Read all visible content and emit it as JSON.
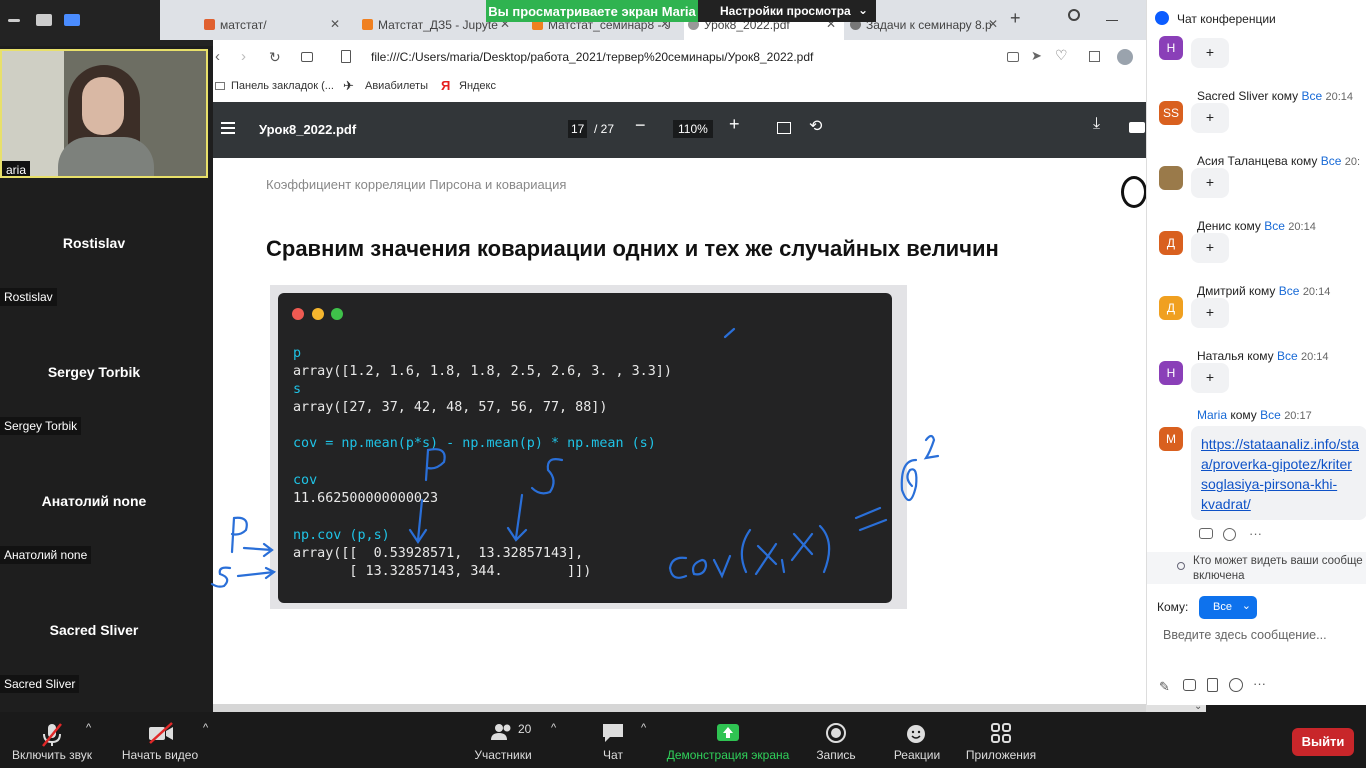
{
  "banner": {
    "sharing_text": "Вы просматриваете экран Maria",
    "view_options": "Настройки просмотра"
  },
  "browser": {
    "tabs": [
      {
        "label": "матстат/"
      },
      {
        "label": "Матстат_ДЗ5 - Jupyte"
      },
      {
        "label": "Матстат_семинар8 - J"
      },
      {
        "label": "Урок8_2022.pdf"
      },
      {
        "label": "Задачи к семинару 8.p"
      }
    ],
    "url": "file:///C:/Users/maria/Desktop/работа_2021/тервер%20семинары/Урок8_2022.pdf",
    "bookmarks": [
      "Панель закладок (...",
      "Авиабилеты",
      "Яндекс"
    ]
  },
  "pdf": {
    "filename": "Урок8_2022.pdf",
    "page_current": "17",
    "page_total": "/ 27",
    "zoom": "110%",
    "header": "Коэффициент корреляции Пирсона и ковариация",
    "title": "Сравним значения ковариации одних и тех же случайных величин",
    "code_lines": [
      "p",
      "array([1.2, 1.6, 1.8, 1.8, 2.5, 2.6, 3. , 3.3])",
      "s",
      "array([27, 37, 42, 48, 57, 56, 77, 88])",
      "cov = np.mean(p*s) - np.mean(p) * np.mean (s)",
      "cov",
      "11.662500000000023",
      "np.cov (p,s)",
      "array([[  0.53928571,  13.32857143],",
      "       [ 13.32857143, 344.        ]])"
    ]
  },
  "participants": [
    {
      "tag": "aria"
    },
    {
      "name": "Rostislav",
      "tag": "Rostislav"
    },
    {
      "name": "Sergey Torbik",
      "tag": "Sergey Torbik"
    },
    {
      "name": "Анатолий none",
      "tag": "Анатолий none"
    },
    {
      "name": "Sacred Sliver",
      "tag": "Sacred Sliver"
    }
  ],
  "chat": {
    "title": "Чат конференции",
    "messages": [
      {
        "initial": "Н",
        "color": "#8a3fb8",
        "sender": "",
        "to": "",
        "time": "",
        "text": "+"
      },
      {
        "initial": "SS",
        "color": "#d9601f",
        "sender": "Sacred Sliver кому",
        "to": "Все",
        "time": "20:14",
        "text": "+"
      },
      {
        "initial": "",
        "color": "#9a7a4a",
        "sender": "Асия Таланцева кому",
        "to": "Все",
        "time": "20:",
        "text": "+"
      },
      {
        "initial": "Д",
        "color": "#d9601f",
        "sender": "Денис кому",
        "to": "Все",
        "time": "20:14",
        "text": "+"
      },
      {
        "initial": "Д",
        "color": "#f0a020",
        "sender": "Дмитрий кому",
        "to": "Все",
        "time": "20:14",
        "text": "+"
      },
      {
        "initial": "Н",
        "color": "#8a3fb8",
        "sender": "Наталья кому",
        "to": "Все",
        "time": "20:14",
        "text": "+"
      }
    ],
    "last": {
      "initial": "M",
      "color": "#d9601f",
      "sender": "Maria",
      "kw": "кому",
      "to": "Все",
      "time": "20:17",
      "link_lines": [
        "https://stataanaliz.info/sta",
        "a/proverka-gipotez/kriter",
        "soglasiya-pirsona-khi-",
        "kvadrat/"
      ]
    },
    "privacy": "Кто может видеть ваши сообще",
    "privacy2": "включена",
    "to_label": "Кому:",
    "to_value": "Все",
    "placeholder": "Введите здесь сообщение..."
  },
  "toolbar": {
    "mute": "Включить звук",
    "video": "Начать видео",
    "participants": "Участники",
    "participants_count": "20",
    "chat": "Чат",
    "share": "Демонстрация экрана",
    "record": "Запись",
    "reactions": "Реакции",
    "apps": "Приложения",
    "leave": "Выйти"
  }
}
